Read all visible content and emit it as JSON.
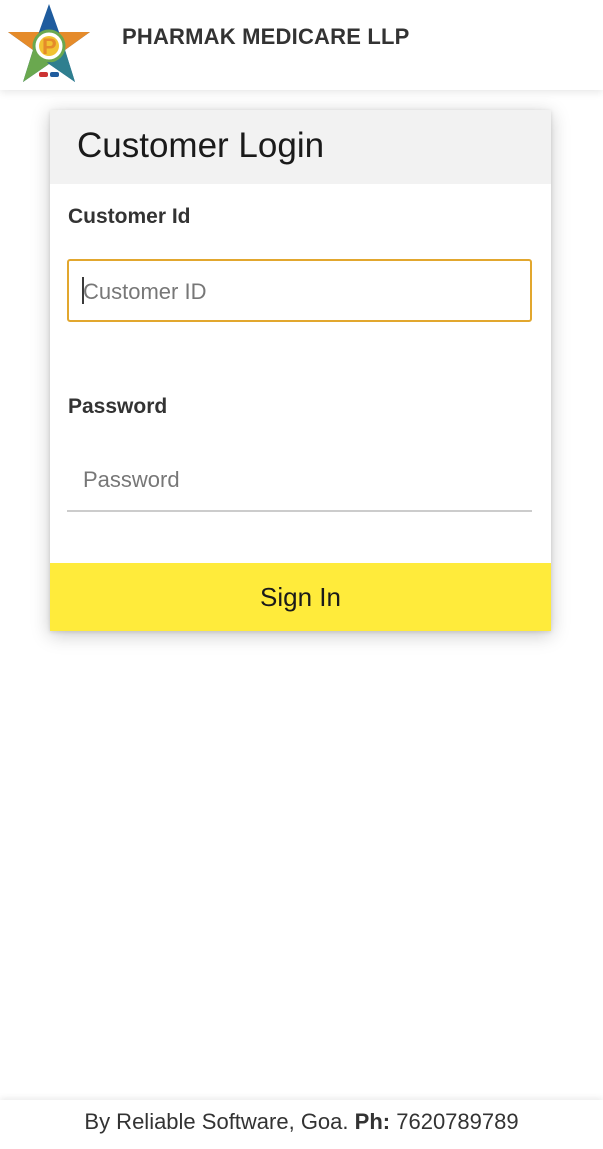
{
  "header": {
    "company_name": "PHARMAK MEDICARE LLP",
    "logo_icon": "pharmak-star-logo",
    "logo_letter": "P"
  },
  "login": {
    "title": "Customer Login",
    "customer_id_label": "Customer Id",
    "customer_id_placeholder": "Customer ID",
    "customer_id_value": "",
    "password_label": "Password",
    "password_placeholder": "Password",
    "password_value": "",
    "sign_in_label": "Sign In"
  },
  "footer": {
    "by_text": "By Reliable Software, Goa.",
    "phone_label": "Ph:",
    "phone_number": "7620789789"
  },
  "colors": {
    "accent_yellow": "#ffeb3b",
    "focus_border": "#e2a72e",
    "card_header_bg": "#f2f2f2",
    "logo_blue": "#1f5c9e",
    "logo_orange": "#e58b2a",
    "logo_green": "#6aa84f"
  }
}
